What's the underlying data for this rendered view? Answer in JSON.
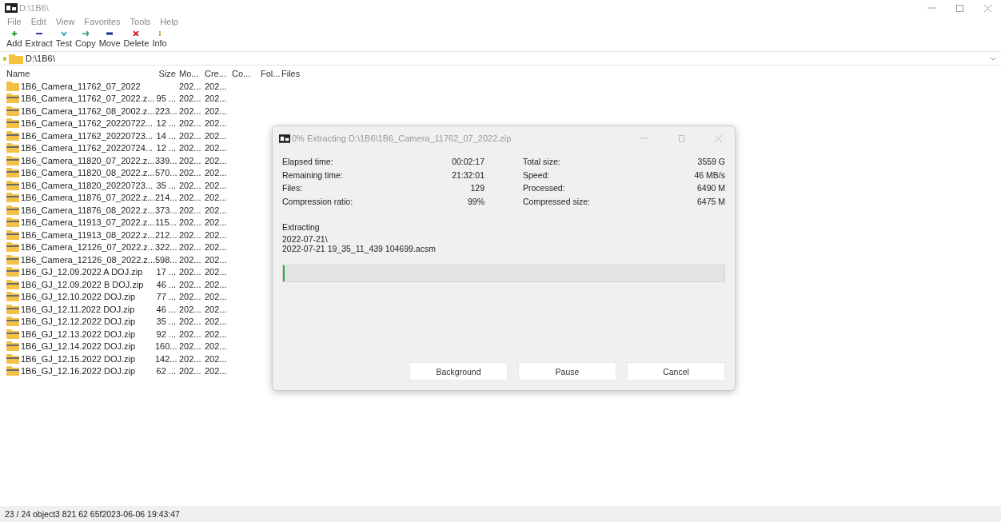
{
  "window": {
    "title": "D:\\1B6\\"
  },
  "menu": [
    "File",
    "Edit",
    "View",
    "Favorites",
    "Tools",
    "Help"
  ],
  "toolbar": [
    {
      "label": "Add",
      "kind": "add"
    },
    {
      "label": "Extract",
      "kind": "extract"
    },
    {
      "label": "Test",
      "kind": "test"
    },
    {
      "label": "Copy",
      "kind": "copy"
    },
    {
      "label": "Move",
      "kind": "move"
    },
    {
      "label": "Delete",
      "kind": "delete"
    },
    {
      "label": "Info",
      "kind": "info"
    }
  ],
  "address": {
    "value": "D:\\1B6\\"
  },
  "table": {
    "columns": [
      "Name",
      "Size",
      "Mo...",
      "Cre...",
      "Co...",
      "Fol...",
      "Files"
    ],
    "rows": [
      {
        "kind": "folder",
        "name": "1B6_Camera_11762_07_2022",
        "size": "",
        "modified": "202...",
        "created": "202..."
      },
      {
        "kind": "zip",
        "name": "1B6_Camera_11762_07_2022.z...",
        "size": "95 ...",
        "modified": "202...",
        "created": "202..."
      },
      {
        "kind": "zip",
        "name": "1B6_Camera_11762_08_2002.z...",
        "size": "223...",
        "modified": "202...",
        "created": "202..."
      },
      {
        "kind": "zip",
        "name": "1B6_Camera_11762_20220722...",
        "size": "12 ...",
        "modified": "202...",
        "created": "202..."
      },
      {
        "kind": "zip",
        "name": "1B6_Camera_11762_20220723...",
        "size": "14 ...",
        "modified": "202...",
        "created": "202..."
      },
      {
        "kind": "zip",
        "name": "1B6_Camera_11762_20220724...",
        "size": "12 ...",
        "modified": "202...",
        "created": "202..."
      },
      {
        "kind": "zip",
        "name": "1B6_Camera_11820_07_2022.z...",
        "size": "339...",
        "modified": "202...",
        "created": "202..."
      },
      {
        "kind": "zip",
        "name": "1B6_Camera_11820_08_2022.z...",
        "size": "570...",
        "modified": "202...",
        "created": "202..."
      },
      {
        "kind": "zip",
        "name": "1B6_Camera_11820_20220723...",
        "size": "35 ...",
        "modified": "202...",
        "created": "202..."
      },
      {
        "kind": "zip",
        "name": "1B6_Camera_11876_07_2022.z...",
        "size": "214...",
        "modified": "202...",
        "created": "202..."
      },
      {
        "kind": "zip",
        "name": "1B6_Camera_11876_08_2022.z...",
        "size": "373...",
        "modified": "202...",
        "created": "202..."
      },
      {
        "kind": "zip",
        "name": "1B6_Camera_11913_07_2022.z...",
        "size": "115...",
        "modified": "202...",
        "created": "202..."
      },
      {
        "kind": "zip",
        "name": "1B6_Camera_11913_08_2022.z...",
        "size": "212...",
        "modified": "202...",
        "created": "202..."
      },
      {
        "kind": "zip",
        "name": "1B6_Camera_12126_07_2022.z...",
        "size": "322...",
        "modified": "202...",
        "created": "202..."
      },
      {
        "kind": "zip",
        "name": "1B6_Camera_12126_08_2022.z...",
        "size": "598...",
        "modified": "202...",
        "created": "202..."
      },
      {
        "kind": "zip",
        "name": "1B6_GJ_12.09.2022 A DOJ.zip",
        "size": "17 ...",
        "modified": "202...",
        "created": "202..."
      },
      {
        "kind": "zip",
        "name": "1B6_GJ_12.09.2022 B DOJ.zip",
        "size": "46 ...",
        "modified": "202...",
        "created": "202..."
      },
      {
        "kind": "zip",
        "name": "1B6_GJ_12.10.2022 DOJ.zip",
        "size": "77 ...",
        "modified": "202...",
        "created": "202..."
      },
      {
        "kind": "zip",
        "name": "1B6_GJ_12.11.2022 DOJ.zip",
        "size": "46 ...",
        "modified": "202...",
        "created": "202..."
      },
      {
        "kind": "zip",
        "name": "1B6_GJ_12.12.2022 DOJ.zip",
        "size": "35 ...",
        "modified": "202...",
        "created": "202..."
      },
      {
        "kind": "zip",
        "name": "1B6_GJ_12.13.2022 DOJ.zip",
        "size": "92 ...",
        "modified": "202...",
        "created": "202..."
      },
      {
        "kind": "zip",
        "name": "1B6_GJ_12.14.2022 DOJ.zip",
        "size": "160...",
        "modified": "202...",
        "created": "202..."
      },
      {
        "kind": "zip",
        "name": "1B6_GJ_12.15.2022 DOJ.zip",
        "size": "142...",
        "modified": "202...",
        "created": "202..."
      },
      {
        "kind": "zip",
        "name": "1B6_GJ_12.16.2022 DOJ.zip",
        "size": "62 ...",
        "modified": "202...",
        "created": "202..."
      }
    ]
  },
  "dialog": {
    "title": "0% Extracting D:\\1B6\\1B6_Camera_11762_07_2022.zip",
    "left_stats": [
      {
        "label": "Elapsed time:",
        "value": "00:02:17"
      },
      {
        "label": "Remaining time:",
        "value": "21:32:01"
      },
      {
        "label": "Files:",
        "value": "129"
      },
      {
        "label": "Compression ratio:",
        "value": "99%"
      }
    ],
    "right_stats": [
      {
        "label": "Total size:",
        "value": "3559 G"
      },
      {
        "label": "Speed:",
        "value": "46 MB/s"
      },
      {
        "label": "Processed:",
        "value": "6490 M"
      },
      {
        "label": "Compressed size:",
        "value": "6475 M"
      }
    ],
    "operation": "Extracting",
    "current_folder": "2022-07-21\\",
    "current_file": "2022-07-21 19_35_11_439 104699.acsm",
    "progress": {
      "level": 0.003
    },
    "buttons": [
      "Background",
      "Pause",
      "Cancel"
    ]
  },
  "status_bar": "23 / 24 object3 821 62 65f2023-06-06 19:43:47"
}
